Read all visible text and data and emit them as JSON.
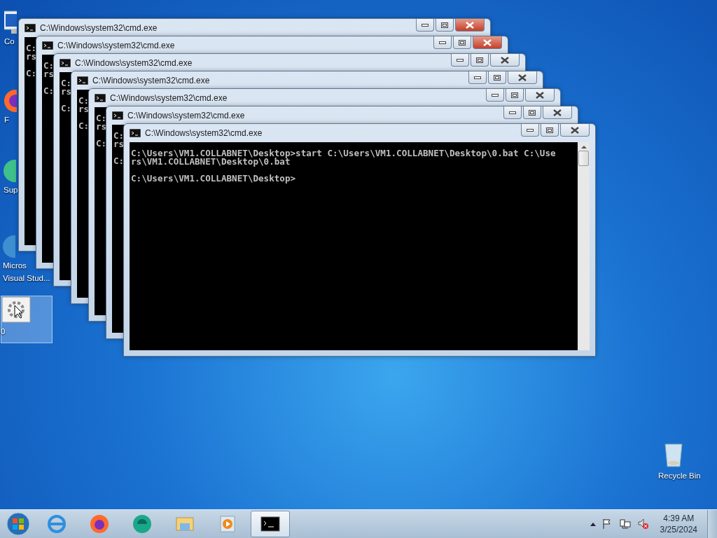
{
  "desktop_icons": [
    {
      "kind": "computer",
      "label": "Co",
      "selected": false
    },
    {
      "kind": "firefox",
      "label": "F",
      "selected": false
    },
    {
      "kind": "app",
      "label": "Sup",
      "selected": false
    },
    {
      "kind": "studio",
      "label": "Micros",
      "label_2": "Visual Stud...",
      "selected": false
    },
    {
      "kind": "batch",
      "label": "0",
      "selected": true
    },
    {
      "kind": "recycle",
      "label": "Recycle Bin",
      "selected": false
    }
  ],
  "windows": [
    {
      "title": "C:\\Windows\\system32\\cmd.exe",
      "active": true,
      "blocks": [
        [
          "C:",
          "rs"
        ],
        [
          "C:"
        ]
      ]
    },
    {
      "title": "C:\\Windows\\system32\\cmd.exe",
      "active": true,
      "blocks": [
        [
          "C:",
          "rs"
        ],
        [
          "C:"
        ]
      ]
    },
    {
      "title": "C:\\Windows\\system32\\cmd.exe",
      "active": false,
      "blocks": [
        [
          "C:",
          "rs"
        ],
        [
          "C:"
        ]
      ]
    },
    {
      "title": "C:\\Windows\\system32\\cmd.exe",
      "active": false,
      "blocks": [
        [
          "C:",
          "rs"
        ],
        [
          "C:"
        ]
      ]
    },
    {
      "title": "C:\\Windows\\system32\\cmd.exe",
      "active": false,
      "blocks": [
        [
          "C:",
          "rs"
        ],
        [
          "C:"
        ]
      ]
    },
    {
      "title": "C:\\Windows\\system32\\cmd.exe",
      "active": false,
      "blocks": [
        [
          "C:",
          "rs"
        ],
        [
          "C:"
        ]
      ]
    },
    {
      "title": "C:\\Windows\\system32\\cmd.exe",
      "active": false,
      "blocks": [
        [
          "C:\\Users\\VM1.COLLABNET\\Desktop>start C:\\Users\\VM1.COLLABNET\\Desktop\\0.bat C:\\Use",
          "rs\\VM1.COLLABNET\\Desktop\\0.bat"
        ],
        [
          "C:\\Users\\VM1.COLLABNET\\Desktop>"
        ]
      ]
    }
  ],
  "taskbar": {
    "apps": [
      {
        "kind": "ie",
        "selected": false
      },
      {
        "kind": "firefox",
        "selected": false
      },
      {
        "kind": "teal",
        "selected": false
      },
      {
        "kind": "explorer",
        "selected": false
      },
      {
        "kind": "media",
        "selected": false
      },
      {
        "kind": "cmd",
        "selected": true
      }
    ],
    "clock": {
      "time": "4:39 AM",
      "date": "3/25/2024"
    }
  }
}
